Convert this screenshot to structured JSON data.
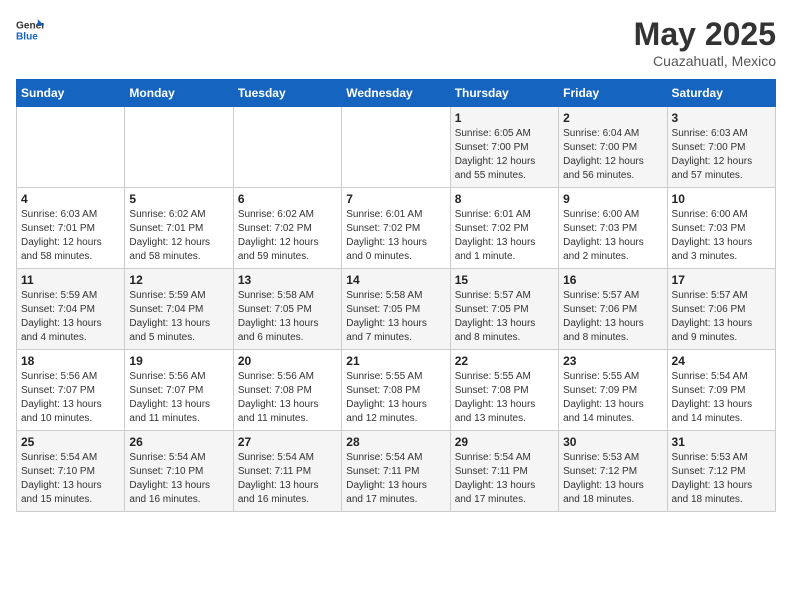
{
  "header": {
    "logo_general": "General",
    "logo_blue": "Blue",
    "title": "May 2025",
    "subtitle": "Cuazahuatl, Mexico"
  },
  "days_of_week": [
    "Sunday",
    "Monday",
    "Tuesday",
    "Wednesday",
    "Thursday",
    "Friday",
    "Saturday"
  ],
  "weeks": [
    [
      {
        "day": "",
        "detail": ""
      },
      {
        "day": "",
        "detail": ""
      },
      {
        "day": "",
        "detail": ""
      },
      {
        "day": "",
        "detail": ""
      },
      {
        "day": "1",
        "detail": "Sunrise: 6:05 AM\nSunset: 7:00 PM\nDaylight: 12 hours\nand 55 minutes."
      },
      {
        "day": "2",
        "detail": "Sunrise: 6:04 AM\nSunset: 7:00 PM\nDaylight: 12 hours\nand 56 minutes."
      },
      {
        "day": "3",
        "detail": "Sunrise: 6:03 AM\nSunset: 7:00 PM\nDaylight: 12 hours\nand 57 minutes."
      }
    ],
    [
      {
        "day": "4",
        "detail": "Sunrise: 6:03 AM\nSunset: 7:01 PM\nDaylight: 12 hours\nand 58 minutes."
      },
      {
        "day": "5",
        "detail": "Sunrise: 6:02 AM\nSunset: 7:01 PM\nDaylight: 12 hours\nand 58 minutes."
      },
      {
        "day": "6",
        "detail": "Sunrise: 6:02 AM\nSunset: 7:02 PM\nDaylight: 12 hours\nand 59 minutes."
      },
      {
        "day": "7",
        "detail": "Sunrise: 6:01 AM\nSunset: 7:02 PM\nDaylight: 13 hours\nand 0 minutes."
      },
      {
        "day": "8",
        "detail": "Sunrise: 6:01 AM\nSunset: 7:02 PM\nDaylight: 13 hours\nand 1 minute."
      },
      {
        "day": "9",
        "detail": "Sunrise: 6:00 AM\nSunset: 7:03 PM\nDaylight: 13 hours\nand 2 minutes."
      },
      {
        "day": "10",
        "detail": "Sunrise: 6:00 AM\nSunset: 7:03 PM\nDaylight: 13 hours\nand 3 minutes."
      }
    ],
    [
      {
        "day": "11",
        "detail": "Sunrise: 5:59 AM\nSunset: 7:04 PM\nDaylight: 13 hours\nand 4 minutes."
      },
      {
        "day": "12",
        "detail": "Sunrise: 5:59 AM\nSunset: 7:04 PM\nDaylight: 13 hours\nand 5 minutes."
      },
      {
        "day": "13",
        "detail": "Sunrise: 5:58 AM\nSunset: 7:05 PM\nDaylight: 13 hours\nand 6 minutes."
      },
      {
        "day": "14",
        "detail": "Sunrise: 5:58 AM\nSunset: 7:05 PM\nDaylight: 13 hours\nand 7 minutes."
      },
      {
        "day": "15",
        "detail": "Sunrise: 5:57 AM\nSunset: 7:05 PM\nDaylight: 13 hours\nand 8 minutes."
      },
      {
        "day": "16",
        "detail": "Sunrise: 5:57 AM\nSunset: 7:06 PM\nDaylight: 13 hours\nand 8 minutes."
      },
      {
        "day": "17",
        "detail": "Sunrise: 5:57 AM\nSunset: 7:06 PM\nDaylight: 13 hours\nand 9 minutes."
      }
    ],
    [
      {
        "day": "18",
        "detail": "Sunrise: 5:56 AM\nSunset: 7:07 PM\nDaylight: 13 hours\nand 10 minutes."
      },
      {
        "day": "19",
        "detail": "Sunrise: 5:56 AM\nSunset: 7:07 PM\nDaylight: 13 hours\nand 11 minutes."
      },
      {
        "day": "20",
        "detail": "Sunrise: 5:56 AM\nSunset: 7:08 PM\nDaylight: 13 hours\nand 11 minutes."
      },
      {
        "day": "21",
        "detail": "Sunrise: 5:55 AM\nSunset: 7:08 PM\nDaylight: 13 hours\nand 12 minutes."
      },
      {
        "day": "22",
        "detail": "Sunrise: 5:55 AM\nSunset: 7:08 PM\nDaylight: 13 hours\nand 13 minutes."
      },
      {
        "day": "23",
        "detail": "Sunrise: 5:55 AM\nSunset: 7:09 PM\nDaylight: 13 hours\nand 14 minutes."
      },
      {
        "day": "24",
        "detail": "Sunrise: 5:54 AM\nSunset: 7:09 PM\nDaylight: 13 hours\nand 14 minutes."
      }
    ],
    [
      {
        "day": "25",
        "detail": "Sunrise: 5:54 AM\nSunset: 7:10 PM\nDaylight: 13 hours\nand 15 minutes."
      },
      {
        "day": "26",
        "detail": "Sunrise: 5:54 AM\nSunset: 7:10 PM\nDaylight: 13 hours\nand 16 minutes."
      },
      {
        "day": "27",
        "detail": "Sunrise: 5:54 AM\nSunset: 7:11 PM\nDaylight: 13 hours\nand 16 minutes."
      },
      {
        "day": "28",
        "detail": "Sunrise: 5:54 AM\nSunset: 7:11 PM\nDaylight: 13 hours\nand 17 minutes."
      },
      {
        "day": "29",
        "detail": "Sunrise: 5:54 AM\nSunset: 7:11 PM\nDaylight: 13 hours\nand 17 minutes."
      },
      {
        "day": "30",
        "detail": "Sunrise: 5:53 AM\nSunset: 7:12 PM\nDaylight: 13 hours\nand 18 minutes."
      },
      {
        "day": "31",
        "detail": "Sunrise: 5:53 AM\nSunset: 7:12 PM\nDaylight: 13 hours\nand 18 minutes."
      }
    ]
  ]
}
